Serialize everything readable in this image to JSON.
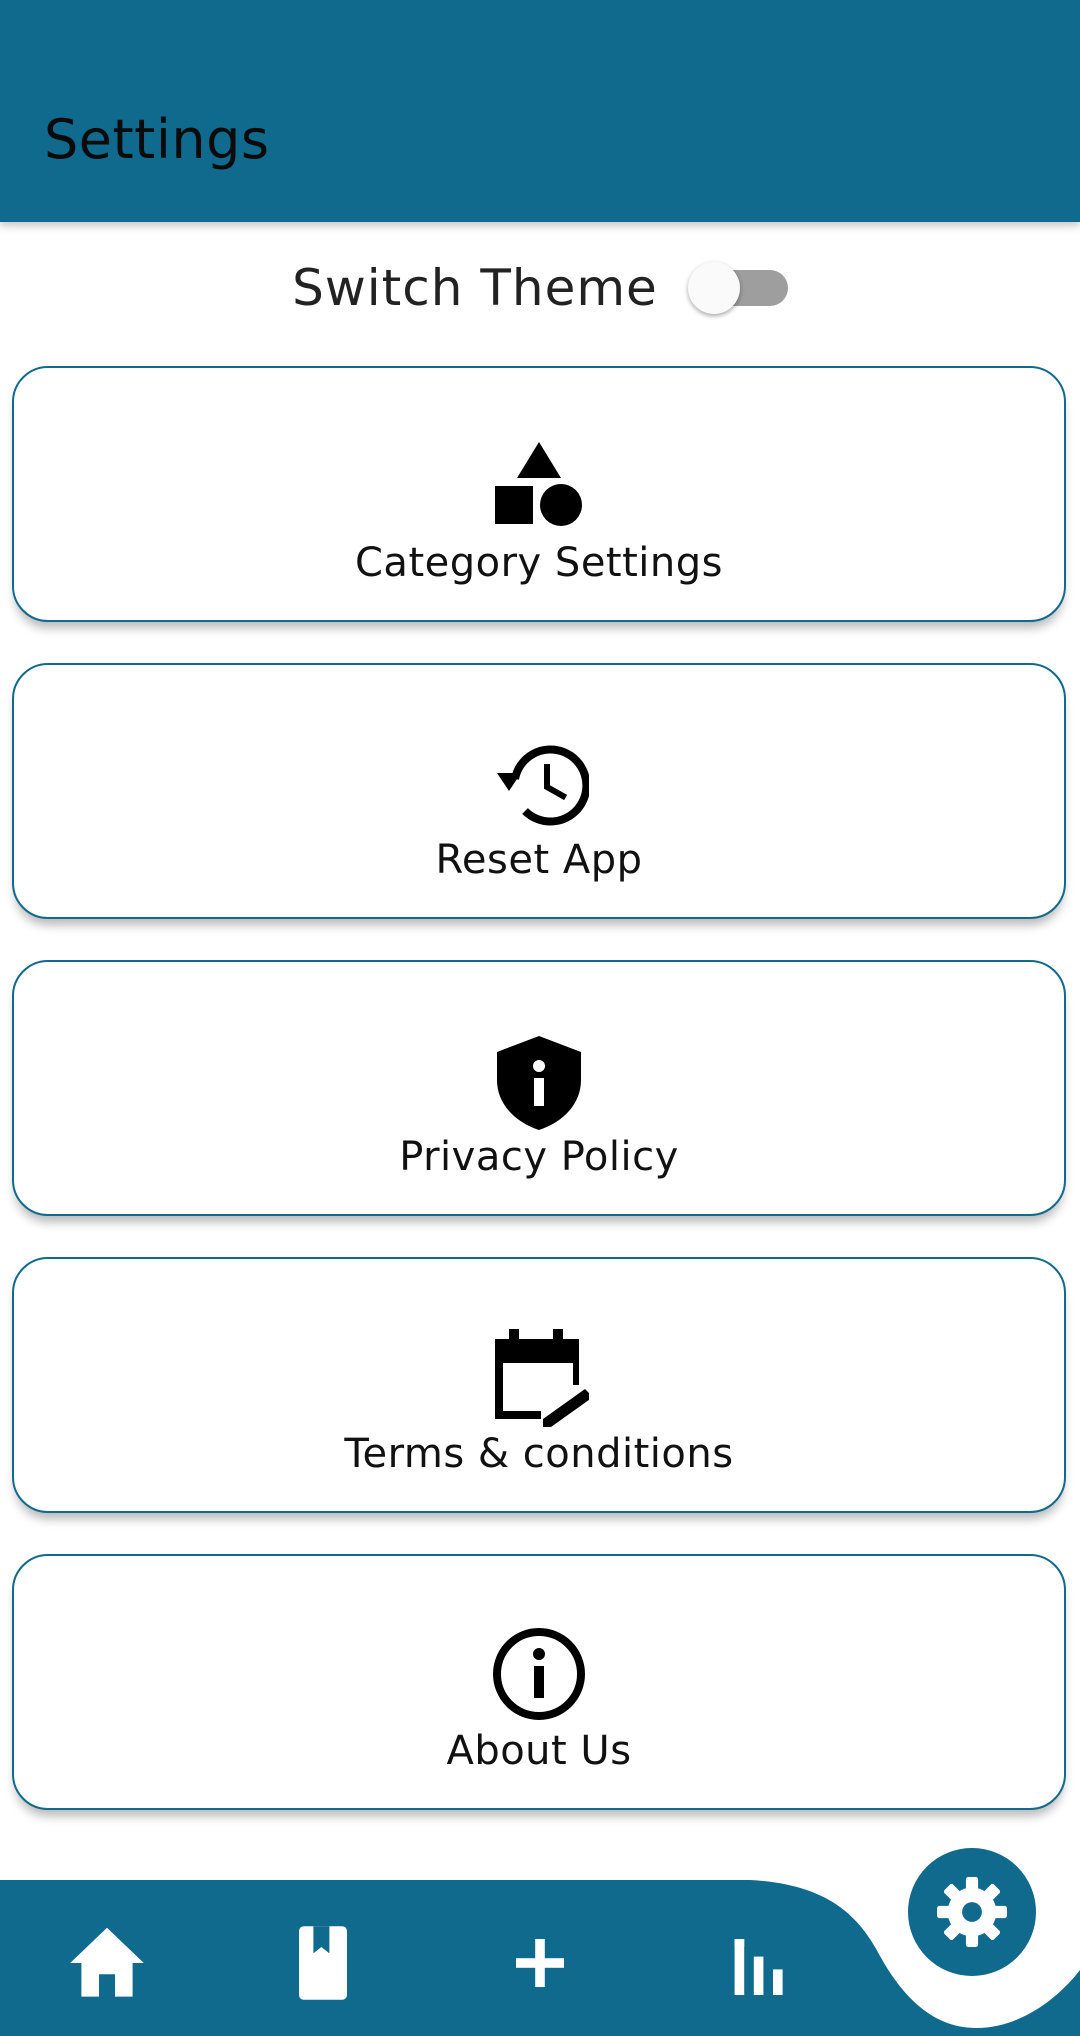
{
  "app_bar": {
    "title": "Settings",
    "background_color": "#0f6a8d"
  },
  "theme_toggle": {
    "label": "Switch Theme",
    "enabled": false
  },
  "cards": [
    {
      "label": "Category Settings",
      "icon": "category-icon"
    },
    {
      "label": "Reset App",
      "icon": "history-icon"
    },
    {
      "label": "Privacy Policy",
      "icon": "shield-info-icon"
    },
    {
      "label": "Terms & conditions",
      "icon": "calendar-edit-icon"
    },
    {
      "label": "About Us",
      "icon": "info-circle-icon"
    }
  ],
  "bottom_nav": {
    "items": [
      {
        "icon": "home-icon"
      },
      {
        "icon": "bookmark-book-icon"
      },
      {
        "icon": "plus-icon"
      },
      {
        "icon": "bar-chart-icon"
      }
    ],
    "active_item": {
      "icon": "gear-icon"
    }
  }
}
